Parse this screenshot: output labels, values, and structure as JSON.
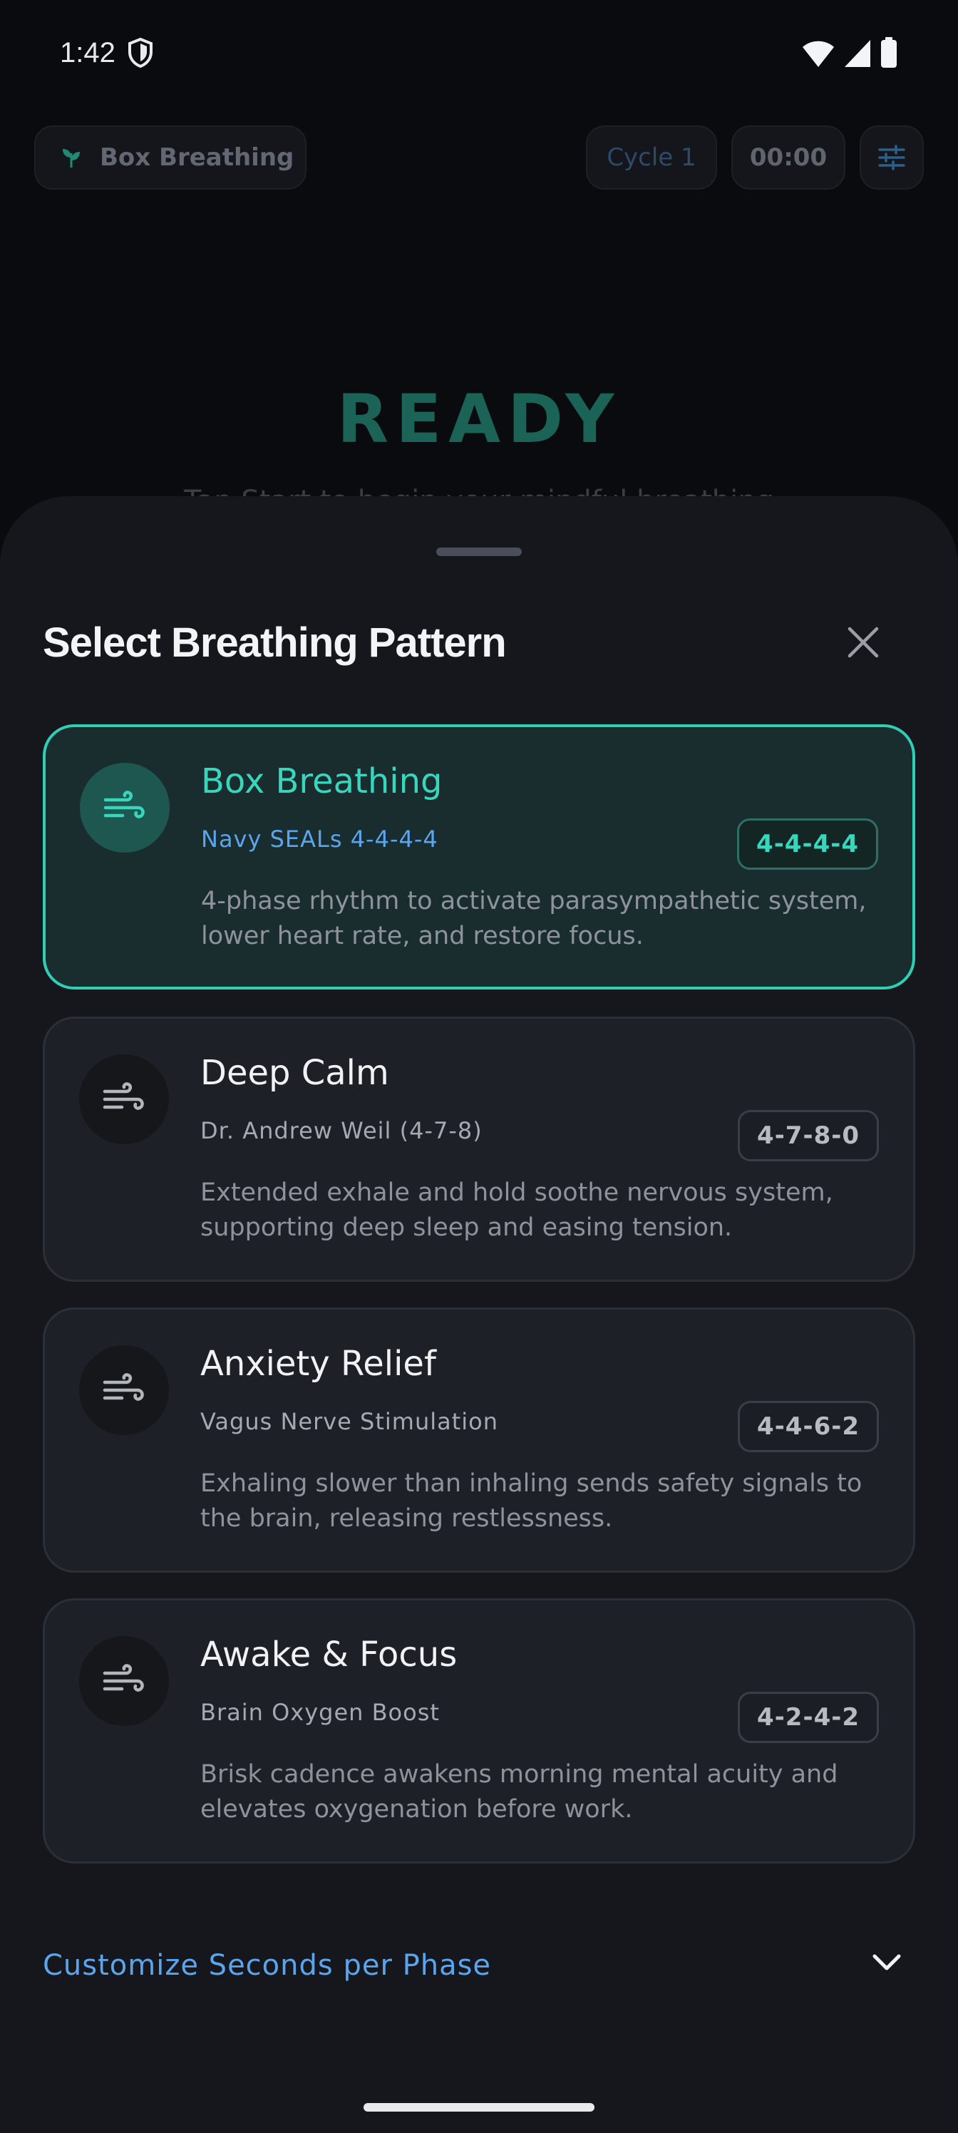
{
  "status_bar": {
    "time": "1:42"
  },
  "header": {
    "pattern_label": "Box Breathing",
    "cycle_label": "Cycle 1",
    "timer": "00:00"
  },
  "main": {
    "state_title": "READY",
    "hint_text": "Tap Start to begin your mindful breathing"
  },
  "sheet": {
    "title": "Select Breathing Pattern",
    "patterns": [
      {
        "name": "Box Breathing",
        "source": "Navy SEALs 4-4-4-4",
        "ratio": "4-4-4-4",
        "description": "4-phase rhythm to activate parasympathetic system, lower heart rate, and restore focus.",
        "selected": true
      },
      {
        "name": "Deep Calm",
        "source": "Dr. Andrew Weil (4-7-8)",
        "ratio": "4-7-8-0",
        "description": "Extended exhale and hold soothe nervous system, supporting deep sleep and easing tension.",
        "selected": false
      },
      {
        "name": "Anxiety Relief",
        "source": "Vagus Nerve Stimulation",
        "ratio": "4-4-6-2",
        "description": "Exhaling slower than inhaling sends safety signals to the brain, releasing restlessness.",
        "selected": false
      },
      {
        "name": "Awake & Focus",
        "source": "Brain Oxygen Boost",
        "ratio": "4-2-4-2",
        "description": "Brisk cadence awakens morning mental acuity and elevates oxygenation before work.",
        "selected": false
      }
    ],
    "customize_label": "Customize Seconds per Phase"
  },
  "colors": {
    "accent_teal": "#38d6bd",
    "accent_blue": "#5aa5ee",
    "sheet_bg": "#15171d",
    "card_bg": "#1d2027"
  },
  "icons": {
    "status": [
      "shield-icon",
      "wifi-icon",
      "signal-icon",
      "battery-icon"
    ],
    "header": [
      "sprout-icon",
      "tune-icon"
    ],
    "cards": "wind-icon",
    "sheet": [
      "close-icon",
      "chevron-down-icon"
    ]
  }
}
